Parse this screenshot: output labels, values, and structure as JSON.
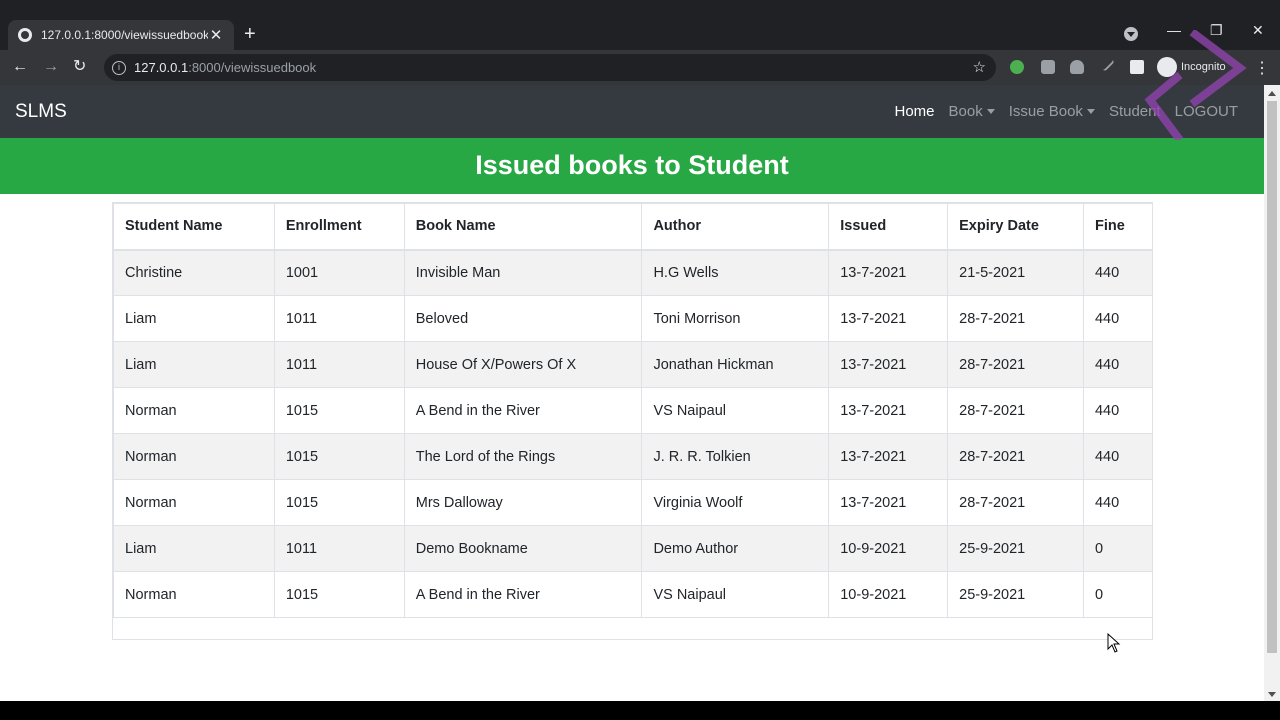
{
  "browser": {
    "tab_title": "127.0.0.1:8000/viewissuedbook",
    "url_host": "127.0.0.1",
    "url_path": ":8000/viewissuedbook",
    "profile_label": "Incognito"
  },
  "site": {
    "brand": "SLMS",
    "nav": [
      {
        "label": "Home",
        "active": true,
        "dropdown": false
      },
      {
        "label": "Book",
        "active": false,
        "dropdown": true
      },
      {
        "label": "Issue Book",
        "active": false,
        "dropdown": true
      },
      {
        "label": "Student",
        "active": false,
        "dropdown": false
      },
      {
        "label": "LOGOUT",
        "active": false,
        "dropdown": false
      }
    ],
    "banner_title": "Issued books to Student"
  },
  "table": {
    "headers": [
      "Student Name",
      "Enrollment",
      "Book Name",
      "Author",
      "Issued",
      "Expiry Date",
      "Fine"
    ],
    "rows": [
      [
        "Christine",
        "1001",
        "Invisible Man",
        "H.G Wells",
        "13-7-2021",
        "21-5-2021",
        "440"
      ],
      [
        "Liam",
        "1011",
        "Beloved",
        "Toni Morrison",
        "13-7-2021",
        "28-7-2021",
        "440"
      ],
      [
        "Liam",
        "1011",
        "House Of X/Powers Of X",
        "Jonathan Hickman",
        "13-7-2021",
        "28-7-2021",
        "440"
      ],
      [
        "Norman",
        "1015",
        "A Bend in the River",
        "VS Naipaul",
        "13-7-2021",
        "28-7-2021",
        "440"
      ],
      [
        "Norman",
        "1015",
        "The Lord of the Rings",
        "J. R. R. Tolkien",
        "13-7-2021",
        "28-7-2021",
        "440"
      ],
      [
        "Norman",
        "1015",
        "Mrs Dalloway",
        "Virginia Woolf",
        "13-7-2021",
        "28-7-2021",
        "440"
      ],
      [
        "Liam",
        "1011",
        "Demo Bookname",
        "Demo Author",
        "10-9-2021",
        "25-9-2021",
        "0"
      ],
      [
        "Norman",
        "1015",
        "A Bend in the River",
        "VS Naipaul",
        "10-9-2021",
        "25-9-2021",
        "0"
      ]
    ]
  },
  "colors": {
    "navbar_bg": "#343a40",
    "banner_bg": "#28a745",
    "stripe": "#f2f2f2"
  }
}
